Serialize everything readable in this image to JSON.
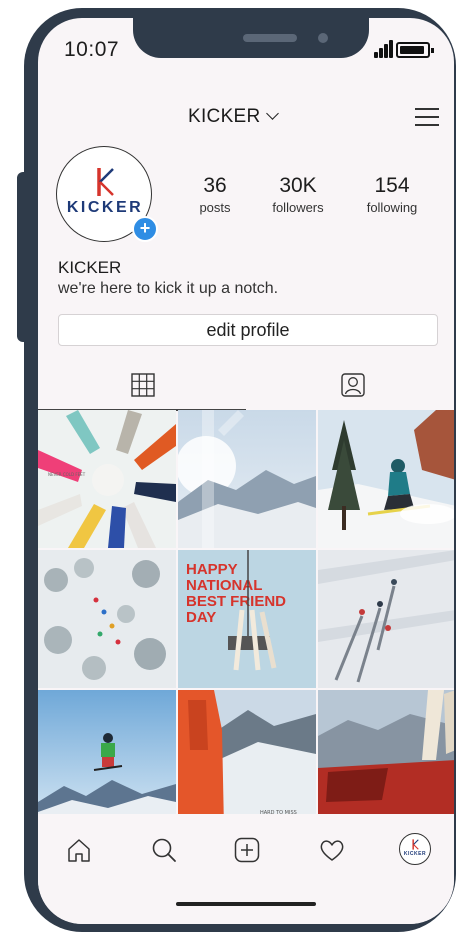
{
  "status_bar": {
    "time": "10:07"
  },
  "header": {
    "username": "KICKER"
  },
  "profile": {
    "logo_text": "KICKER",
    "stats": [
      {
        "value": "36",
        "label": "posts"
      },
      {
        "value": "30K",
        "label": "followers"
      },
      {
        "value": "154",
        "label": "following"
      }
    ],
    "name": "KICKER",
    "bio": "we're here to kick it up a notch.",
    "edit_label": "edit profile"
  },
  "posts": [
    {
      "subject": "ski-socks-circle",
      "caption": ""
    },
    {
      "subject": "sunlit-mountain-valley",
      "caption": ""
    },
    {
      "subject": "skier-powder-turn",
      "caption": ""
    },
    {
      "subject": "aerial-snowy-trees-skiers",
      "caption": ""
    },
    {
      "subject": "national-best-friend-day",
      "caption": "HAPPY NATIONAL BEST FRIEND DAY"
    },
    {
      "subject": "aerial-skiers-slope",
      "caption": ""
    },
    {
      "subject": "skier-jump-sky",
      "caption": ""
    },
    {
      "subject": "red-jacket-mountains",
      "caption": ""
    },
    {
      "subject": "red-car-skis",
      "caption": ""
    }
  ],
  "colors": {
    "accent": "#2f8de4",
    "brand_red": "#d6342c",
    "brand_navy": "#1e3a78",
    "frame": "#2f3b4a"
  },
  "nav_icons": [
    "home-icon",
    "search-icon",
    "add-post-icon",
    "heart-icon",
    "profile-avatar"
  ],
  "tab_icons": [
    "grid-icon",
    "tagged-icon"
  ]
}
